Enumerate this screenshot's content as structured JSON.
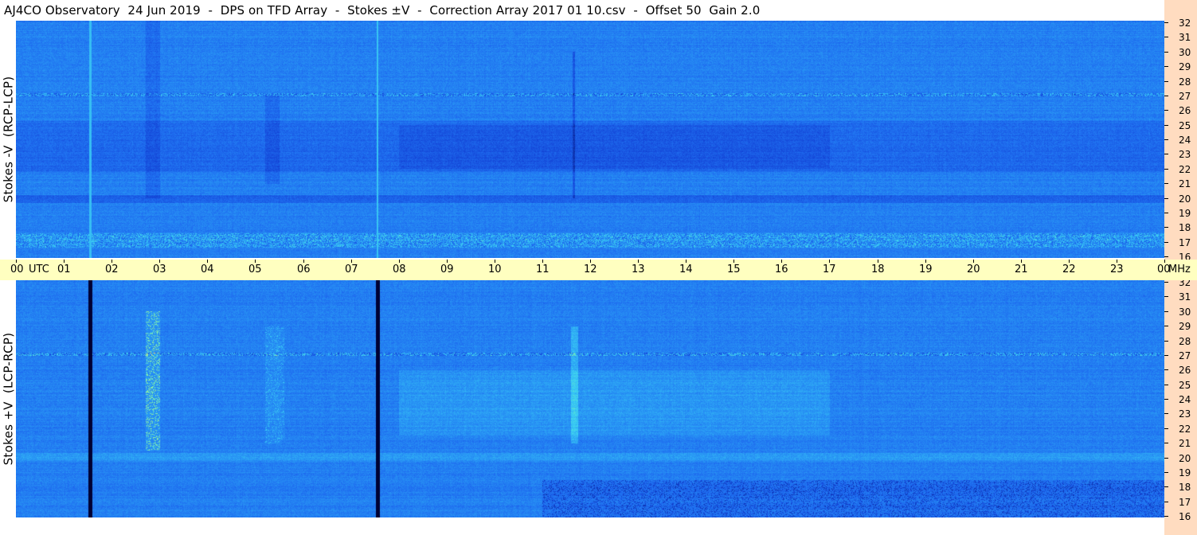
{
  "title": "AJ4CO Observatory  24 Jun 2019  -  DPS on TFD Array  -  Stokes ±V  -  Correction Array 2017 01 10.csv  -  Offset 50  Gain 2.0",
  "chart_data": [
    {
      "type": "heatmap",
      "panel": "top",
      "ylabel": "Stokes -V  (RCP-LCP)",
      "x": [
        "00",
        "01",
        "02",
        "03",
        "04",
        "05",
        "06",
        "07",
        "08",
        "09",
        "10",
        "11",
        "12",
        "13",
        "14",
        "15",
        "16",
        "17",
        "18",
        "19",
        "20",
        "21",
        "22",
        "23",
        "00"
      ],
      "xlabel": "UTC",
      "xlim": [
        0,
        24
      ],
      "y": [
        "16",
        "17",
        "18",
        "19",
        "20",
        "21",
        "22",
        "23",
        "24",
        "25",
        "26",
        "27",
        "28",
        "29",
        "30",
        "31",
        "32"
      ],
      "yunit": "MHz",
      "ylim": [
        16,
        32
      ],
      "colormap": [
        "#000033",
        "#0a2a9a",
        "#1446d8",
        "#1f6ff0",
        "#2a9cf5",
        "#3cd2f2",
        "#8cf0a0",
        "#ffe060",
        "#ff6040"
      ]
    },
    {
      "type": "heatmap",
      "panel": "bottom",
      "ylabel": "Stokes +V  (LCP-RCP)",
      "x": [
        "00",
        "01",
        "02",
        "03",
        "04",
        "05",
        "06",
        "07",
        "08",
        "09",
        "10",
        "11",
        "12",
        "13",
        "14",
        "15",
        "16",
        "17",
        "18",
        "19",
        "20",
        "21",
        "22",
        "23",
        "00"
      ],
      "xlabel": "UTC",
      "xlim": [
        0,
        24
      ],
      "y": [
        "16",
        "17",
        "18",
        "19",
        "20",
        "21",
        "22",
        "23",
        "24",
        "25",
        "26",
        "27",
        "28",
        "29",
        "30",
        "31",
        "32"
      ],
      "yunit": "MHz",
      "ylim": [
        16,
        32
      ],
      "colormap": [
        "#000033",
        "#0a2a9a",
        "#1446d8",
        "#1f6ff0",
        "#2a9cf5",
        "#3cd2f2",
        "#8cf0a0",
        "#ffe060",
        "#ff6040"
      ]
    }
  ],
  "time_axis": {
    "ticks": [
      "00",
      "01",
      "02",
      "03",
      "04",
      "05",
      "06",
      "07",
      "08",
      "09",
      "10",
      "11",
      "12",
      "13",
      "14",
      "15",
      "16",
      "17",
      "18",
      "19",
      "20",
      "21",
      "22",
      "23",
      "00"
    ],
    "utc_label": "UTC",
    "unit_label": "MHz"
  },
  "colors": {
    "time_axis_bg": "#ffffc0",
    "right_strip_bg": "#ffdcc0",
    "spectrogram_base": "#1a5ee8"
  }
}
